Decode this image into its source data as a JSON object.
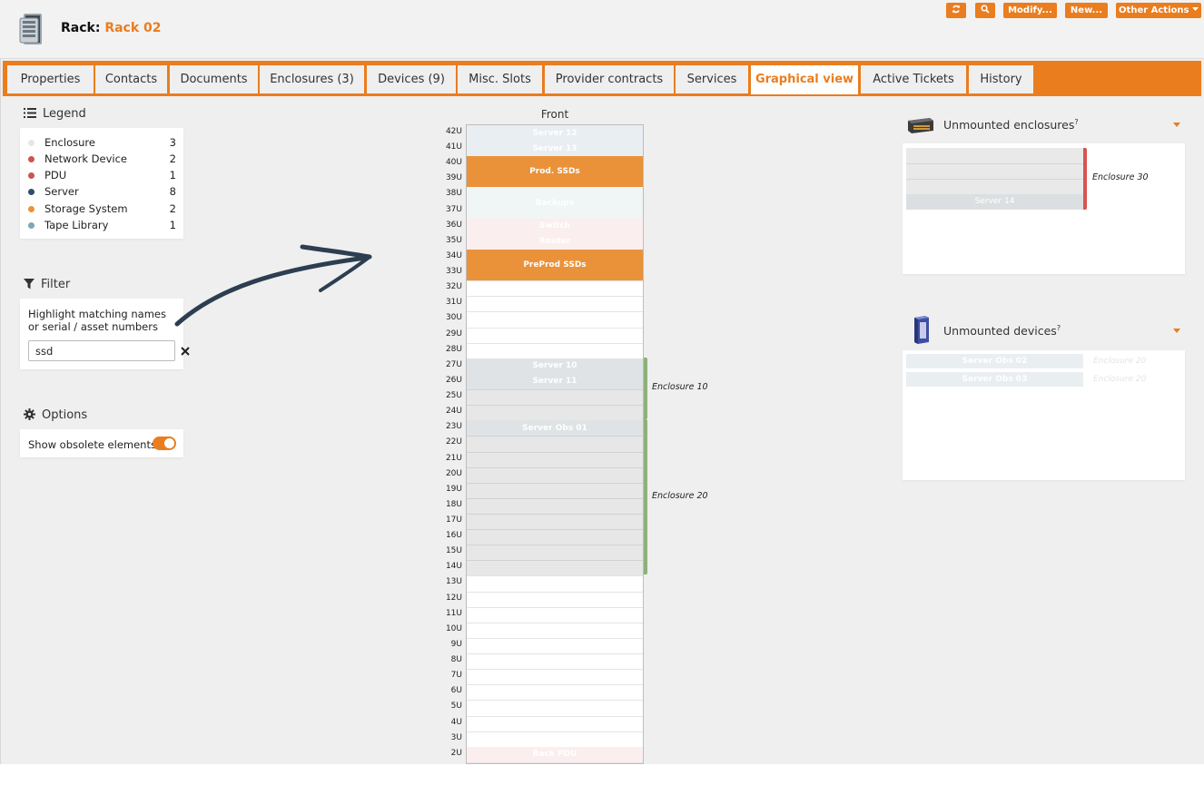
{
  "header": {
    "title_prefix": "Rack:",
    "title_name": "Rack 02",
    "buttons": {
      "modify": "Modify...",
      "new": "New...",
      "other_actions": "Other Actions"
    }
  },
  "tabs": [
    {
      "label": "Properties"
    },
    {
      "label": "Contacts"
    },
    {
      "label": "Documents"
    },
    {
      "label": "Enclosures (3)"
    },
    {
      "label": "Devices (9)"
    },
    {
      "label": "Misc. Slots"
    },
    {
      "label": "Provider contracts"
    },
    {
      "label": "Services"
    },
    {
      "label": "Graphical view",
      "active": true
    },
    {
      "label": "Active Tickets"
    },
    {
      "label": "History"
    }
  ],
  "legend": {
    "title": "Legend",
    "items": [
      {
        "label": "Enclosure",
        "count": "3",
        "color": "#e6e6e6"
      },
      {
        "label": "Network Device",
        "count": "2",
        "color": "#c9564f"
      },
      {
        "label": "PDU",
        "count": "1",
        "color": "#c9564f"
      },
      {
        "label": "Server",
        "count": "8",
        "color": "#2f4e6a"
      },
      {
        "label": "Storage System",
        "count": "2",
        "color": "#ea923a"
      },
      {
        "label": "Tape Library",
        "count": "1",
        "color": "#7fa7b8"
      }
    ]
  },
  "filter": {
    "title": "Filter",
    "description": "Highlight matching names or serial / asset numbers",
    "value": "ssd"
  },
  "options": {
    "title": "Options",
    "show_obsolete_label": "Show obsolete elements",
    "help_mark": "?",
    "show_obsolete_enabled": true
  },
  "rack": {
    "face_label": "Front",
    "units": [
      "42U",
      "41U",
      "40U",
      "39U",
      "38U",
      "37U",
      "36U",
      "35U",
      "34U",
      "33U",
      "32U",
      "31U",
      "30U",
      "29U",
      "28U",
      "27U",
      "26U",
      "25U",
      "24U",
      "23U",
      "22U",
      "21U",
      "20U",
      "19U",
      "18U",
      "17U",
      "16U",
      "15U",
      "14U",
      "13U",
      "12U",
      "11U",
      "10U",
      "9U",
      "8U",
      "7U",
      "6U",
      "5U",
      "4U",
      "3U",
      "2U"
    ],
    "items": [
      {
        "name": "Server 12",
        "top_u": 42,
        "height_u": 1,
        "color": "#e9eef2",
        "highlight": false
      },
      {
        "name": "Server 13",
        "top_u": 41,
        "height_u": 1,
        "color": "#e9eef2",
        "highlight": false
      },
      {
        "name": "Prod. SSDs",
        "top_u": 40,
        "height_u": 2,
        "color": "#ea923a",
        "highlight": true
      },
      {
        "name": "Backups",
        "top_u": 38,
        "height_u": 2,
        "color": "#f0f5f6",
        "highlight": false
      },
      {
        "name": "Switch",
        "top_u": 36,
        "height_u": 1,
        "color": "#fbeeee",
        "highlight": false
      },
      {
        "name": "Router",
        "top_u": 35,
        "height_u": 1,
        "color": "#fbeeee",
        "highlight": false
      },
      {
        "name": "PreProd SSDs",
        "top_u": 34,
        "height_u": 2,
        "color": "#ea923a",
        "highlight": true
      },
      {
        "name": "Server 10",
        "top_u": 27,
        "height_u": 1,
        "color": "#dfe3e5",
        "highlight": false
      },
      {
        "name": "Server 11",
        "top_u": 26,
        "height_u": 1,
        "color": "#dfe3e5",
        "highlight": false
      },
      {
        "name": "Server Obs 01",
        "top_u": 23,
        "height_u": 1,
        "color": "#dfe3e5",
        "highlight": false
      },
      {
        "name": "Rack PDU",
        "top_u": 2,
        "height_u": 1,
        "color": "#fbeeee",
        "highlight": false
      }
    ],
    "enclosures": [
      {
        "name": "Enclosure 10",
        "top_u": 27,
        "height_u": 4
      },
      {
        "name": "Enclosure 20",
        "top_u": 23,
        "height_u": 10
      }
    ]
  },
  "unmounted_enclosures": {
    "title": "Unmounted enclosures",
    "help_mark": "?",
    "enclosure_label": "Enclosure 30",
    "server_label": "Server 14"
  },
  "unmounted_devices": {
    "title": "Unmounted devices",
    "help_mark": "?",
    "items": [
      {
        "name": "Server Obs 02",
        "link": "Enclosure 20"
      },
      {
        "name": "Server Obs 03",
        "link": "Enclosure 20"
      }
    ]
  }
}
